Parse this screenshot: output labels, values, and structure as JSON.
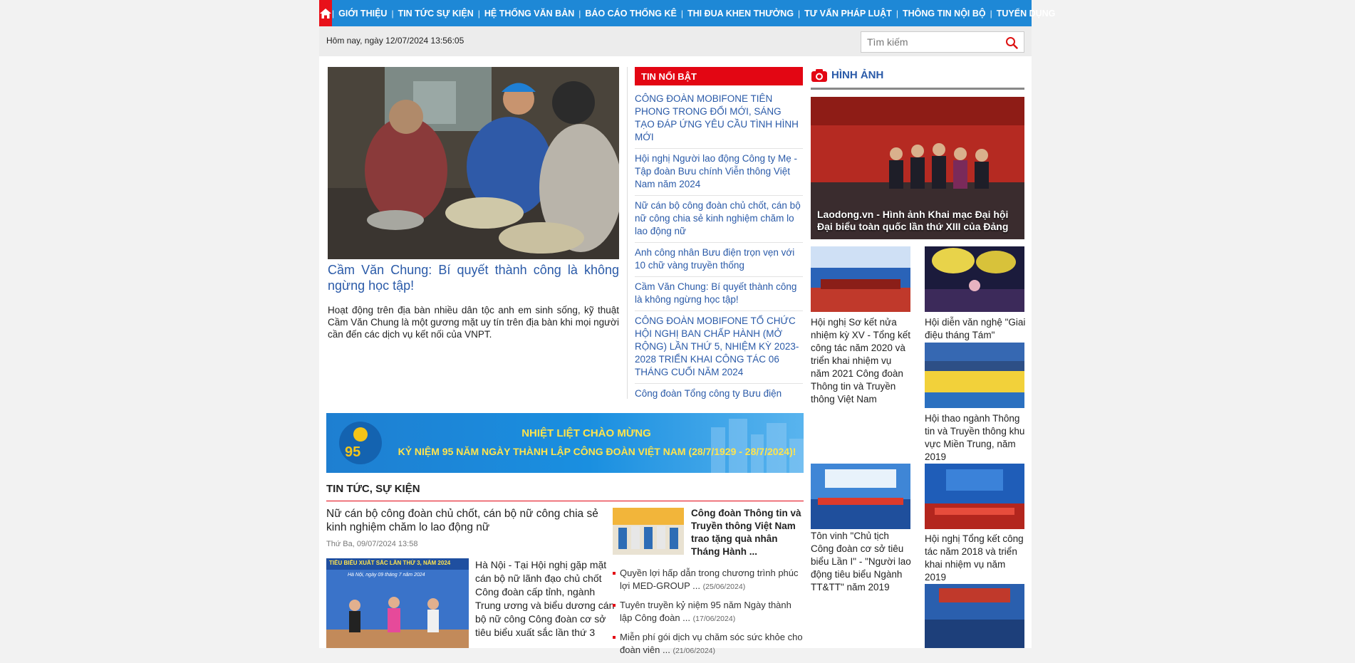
{
  "nav": {
    "home_icon": "home-icon",
    "items": [
      "GIỚI THIỆU",
      "TIN TỨC SỰ KIỆN",
      "HỆ THỐNG VĂN BẢN",
      "BÁO CÁO THỐNG KÊ",
      "THI ĐUA KHEN THƯỞNG",
      "TƯ VẤN PHÁP LUẬT",
      "THÔNG TIN NỘI BỘ",
      "TUYỂN DỤNG"
    ],
    "separator": "|"
  },
  "datebar": {
    "date_text": "Hôm nay, ngày 12/07/2024 13:56:05",
    "search_placeholder": "Tìm kiếm",
    "search_icon": "search-icon"
  },
  "feature": {
    "title": "Cầm Văn Chung: Bí quyết thành công là không ngừng học tập!",
    "summary": "Hoạt động trên địa bàn nhiều dân tộc anh em sinh sống, kỹ thuật Cầm Văn Chung là một gương mặt uy tín trên địa bàn khi mọi người cần đến các dịch vụ kết nối của VNPT."
  },
  "hot_news": {
    "heading": "TIN NỔI BẬT",
    "items": [
      "CÔNG ĐOÀN MOBIFONE TIÊN PHONG TRONG ĐỔI MỚI, SÁNG TẠO ĐÁP ỨNG YÊU CẦU TÌNH HÌNH MỚI",
      "Hội nghị Người lao động Công ty Mẹ - Tập đoàn Bưu chính Viễn thông Việt Nam năm 2024",
      "Nữ cán bộ công đoàn chủ chốt, cán bộ nữ công chia sẻ kinh nghiệm chăm lo lao động nữ",
      "Anh công nhân Bưu điện trọn vẹn với 10 chữ vàng truyền thống",
      "Cầm Văn Chung: Bí quyết thành công là không ngừng học tập!",
      "CÔNG ĐOÀN MOBIFONE TỔ CHỨC HỘI NGHỊ BAN CHẤP HÀNH (MỞ RỘNG) LẦN THỨ 5, NHIỆM KỲ 2023-2028 TRIỂN KHAI CÔNG TÁC 06 THÁNG CUỐI NĂM 2024",
      "Công đoàn Tổng công ty Bưu điện"
    ]
  },
  "photos": {
    "heading": "HÌNH ẢNH",
    "camera_icon": "camera-icon",
    "main_caption": "Laodong.vn - Hình ảnh Khai mạc Đại hội Đại biểu toàn quốc lần thứ XIII của Đảng",
    "thumbs": [
      "Hội nghị Sơ kết nửa nhiệm kỳ XV - Tổng kết công tác năm 2020 và triển khai nhiệm vụ năm 2021 Công đoàn Thông tin và Truyền thông Việt Nam",
      "Hội diễn văn nghệ \"Giai điệu tháng Tám\"",
      "Hội thao ngành Thông tin và Truyền thông khu vực Miền Trung, năm 2019",
      "Tôn vinh \"Chủ tịch Công đoàn cơ sở tiêu biểu Lần I\" - \"Người lao động tiêu biểu Ngành TT&TT\" năm 2019",
      "Hội nghị Tổng kết công tác năm 2018 và triển khai nhiệm vụ năm 2019"
    ]
  },
  "banner": {
    "line1": "NHIỆT LIỆT CHÀO MỪNG",
    "line2": "KỶ NIỆM 95 NĂM NGÀY THÀNH LẬP CÔNG ĐOÀN VIỆT NAM (28/7/1929 - 28/7/2024)!",
    "logo_text": "95"
  },
  "news": {
    "heading": "TIN TỨC, SỰ KIỆN",
    "lead": {
      "title": "Nữ cán bộ công đoàn chủ chốt, cán bộ nữ công chia sẻ kinh nghiệm chăm lo lao động nữ",
      "date": "Thứ Ba, 09/07/2024 13:58",
      "image_banner": "TIÊU BIỂU XUẤT SẮC LẦN THỨ 3, NĂM 2024",
      "image_sub": "Hà Nội, ngày 09 tháng 7 năm 2024",
      "summary": "Hà Nội - Tại Hội nghị gặp mặt cán bộ nữ lãnh đạo chủ chốt Công đoàn cấp tỉnh, ngành Trung ương và biểu dương cán bộ nữ công Công đoàn cơ sở tiêu biểu xuất sắc lần thứ 3"
    },
    "side": {
      "title": "Công đoàn Thông tin và Truyền thông Việt Nam trao tặng quà nhân Tháng Hành ...",
      "items": [
        {
          "text": "Quyền lợi hấp dẫn trong chương trình phúc lợi MED-GROUP ...",
          "date": "(25/06/2024)"
        },
        {
          "text": "Tuyên truyền kỷ niệm 95 năm Ngày thành lập Công đoàn ...",
          "date": "(17/06/2024)"
        },
        {
          "text": "Miễn phí gói dịch vụ chăm sóc sức khỏe cho đoàn viên ...",
          "date": "(21/06/2024)"
        }
      ]
    }
  },
  "colors": {
    "nav_bg": "#1e88d6",
    "accent_red": "#e30613",
    "link_blue": "#2a5aa8"
  }
}
